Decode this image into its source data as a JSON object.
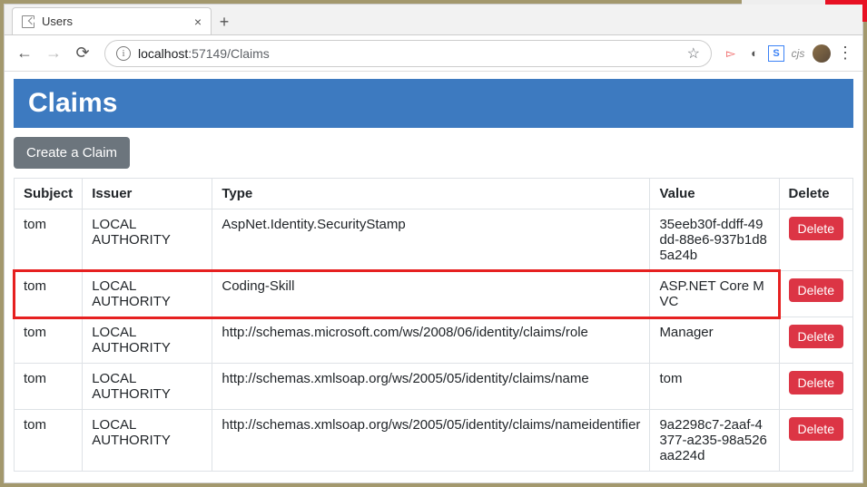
{
  "window": {
    "tab_title": "Users",
    "url_host": "localhost",
    "url_port_path": ":57149/Claims"
  },
  "ext": {
    "cjs": "cjs"
  },
  "page": {
    "title": "Claims",
    "create_label": "Create a Claim",
    "headers": {
      "subject": "Subject",
      "issuer": "Issuer",
      "type": "Type",
      "value": "Value",
      "delete": "Delete"
    },
    "delete_label": "Delete",
    "rows": [
      {
        "subject": "tom",
        "issuer": "LOCAL AUTHORITY",
        "type": "AspNet.Identity.SecurityStamp",
        "value": "35eeb30f-ddff-49dd-88e6-937b1d85a24b",
        "highlight": false
      },
      {
        "subject": "tom",
        "issuer": "LOCAL AUTHORITY",
        "type": "Coding-Skill",
        "value": "ASP.NET Core MVC",
        "highlight": true
      },
      {
        "subject": "tom",
        "issuer": "LOCAL AUTHORITY",
        "type": "http://schemas.microsoft.com/ws/2008/06/identity/claims/role",
        "value": "Manager",
        "highlight": false
      },
      {
        "subject": "tom",
        "issuer": "LOCAL AUTHORITY",
        "type": "http://schemas.xmlsoap.org/ws/2005/05/identity/claims/name",
        "value": "tom",
        "highlight": false
      },
      {
        "subject": "tom",
        "issuer": "LOCAL AUTHORITY",
        "type": "http://schemas.xmlsoap.org/ws/2005/05/identity/claims/nameidentifier",
        "value": "9a2298c7-2aaf-4377-a235-98a526aa224d",
        "highlight": false
      }
    ]
  }
}
